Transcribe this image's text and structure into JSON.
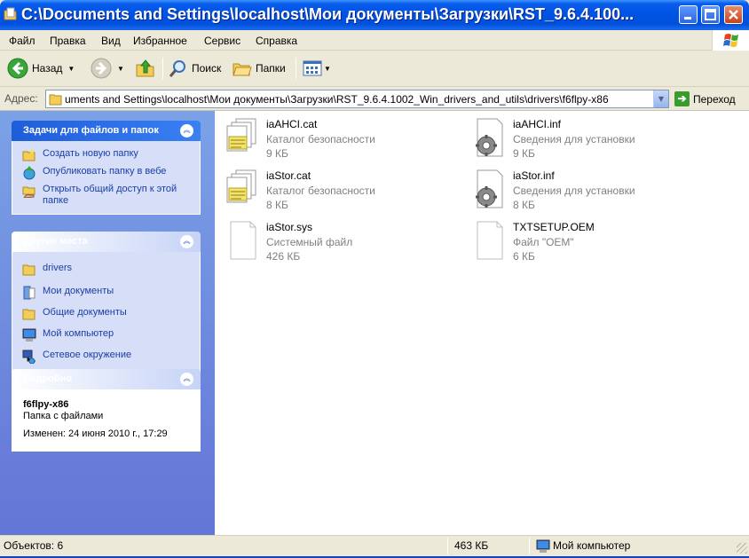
{
  "window": {
    "title": "C:\\Documents and Settings\\localhost\\Мои документы\\Загрузки\\RST_9.6.4.100...",
    "icon": "folder-icon",
    "controls": [
      "minimize",
      "maximize",
      "close"
    ]
  },
  "menu": {
    "items": [
      "Файл",
      "Правка",
      "Вид",
      "Избранное",
      "Сервис",
      "Справка"
    ]
  },
  "toolbar": {
    "back_label": "Назад",
    "search_label": "Поиск",
    "folders_label": "Папки"
  },
  "address": {
    "label": "Адрес:",
    "path": "uments and Settings\\localhost\\Мои документы\\Загрузки\\RST_9.6.4.1002_Win_drivers_and_utils\\drivers\\f6flpy-x86",
    "go_label": "Переход"
  },
  "left_pane": {
    "tasks": {
      "title": "Задачи для файлов и папок",
      "items": [
        {
          "label": "Создать новую папку",
          "icon": "new-folder-icon"
        },
        {
          "label": "Опубликовать папку в вебе",
          "icon": "publish-web-icon"
        },
        {
          "label": "Открыть общий доступ к этой папке",
          "icon": "share-folder-icon"
        }
      ]
    },
    "places": {
      "title": "Другие места",
      "items": [
        {
          "label": "drivers",
          "icon": "folder-icon"
        },
        {
          "label": "Мои документы",
          "icon": "my-documents-icon"
        },
        {
          "label": "Общие документы",
          "icon": "folder-icon"
        },
        {
          "label": "Мой компьютер",
          "icon": "computer-icon"
        },
        {
          "label": "Сетевое окружение",
          "icon": "network-icon"
        }
      ]
    },
    "details": {
      "title": "Подробно",
      "name": "f6flpy-x86",
      "type": "Папка с файлами",
      "modified": "Изменен: 24 июня 2010 г., 17:29"
    }
  },
  "files": [
    {
      "name": "iaAHCI.cat",
      "type": "Каталог безопасности",
      "size": "9 КБ",
      "icon": "security-catalog-icon"
    },
    {
      "name": "iaAHCI.inf",
      "type": "Сведения для установки",
      "size": "9 КБ",
      "icon": "setup-info-icon"
    },
    {
      "name": "iaStor.cat",
      "type": "Каталог безопасности",
      "size": "8 КБ",
      "icon": "security-catalog-icon"
    },
    {
      "name": "iaStor.inf",
      "type": "Сведения для установки",
      "size": "8 КБ",
      "icon": "setup-info-icon"
    },
    {
      "name": "iaStor.sys",
      "type": "Системный файл",
      "size": "426 КБ",
      "icon": "system-file-icon"
    },
    {
      "name": "TXTSETUP.OEM",
      "type": "Файл \"OEM\"",
      "size": "6 КБ",
      "icon": "generic-file-icon"
    }
  ],
  "status": {
    "objects": "Объектов: 6",
    "size": "463 КБ",
    "location": "Мой компьютер"
  },
  "colors": {
    "title_bar": "#0054E3",
    "task_pane": "#7BA2E7",
    "link_text": "#1A3DA8",
    "panel_body": "#D6DFF7"
  }
}
